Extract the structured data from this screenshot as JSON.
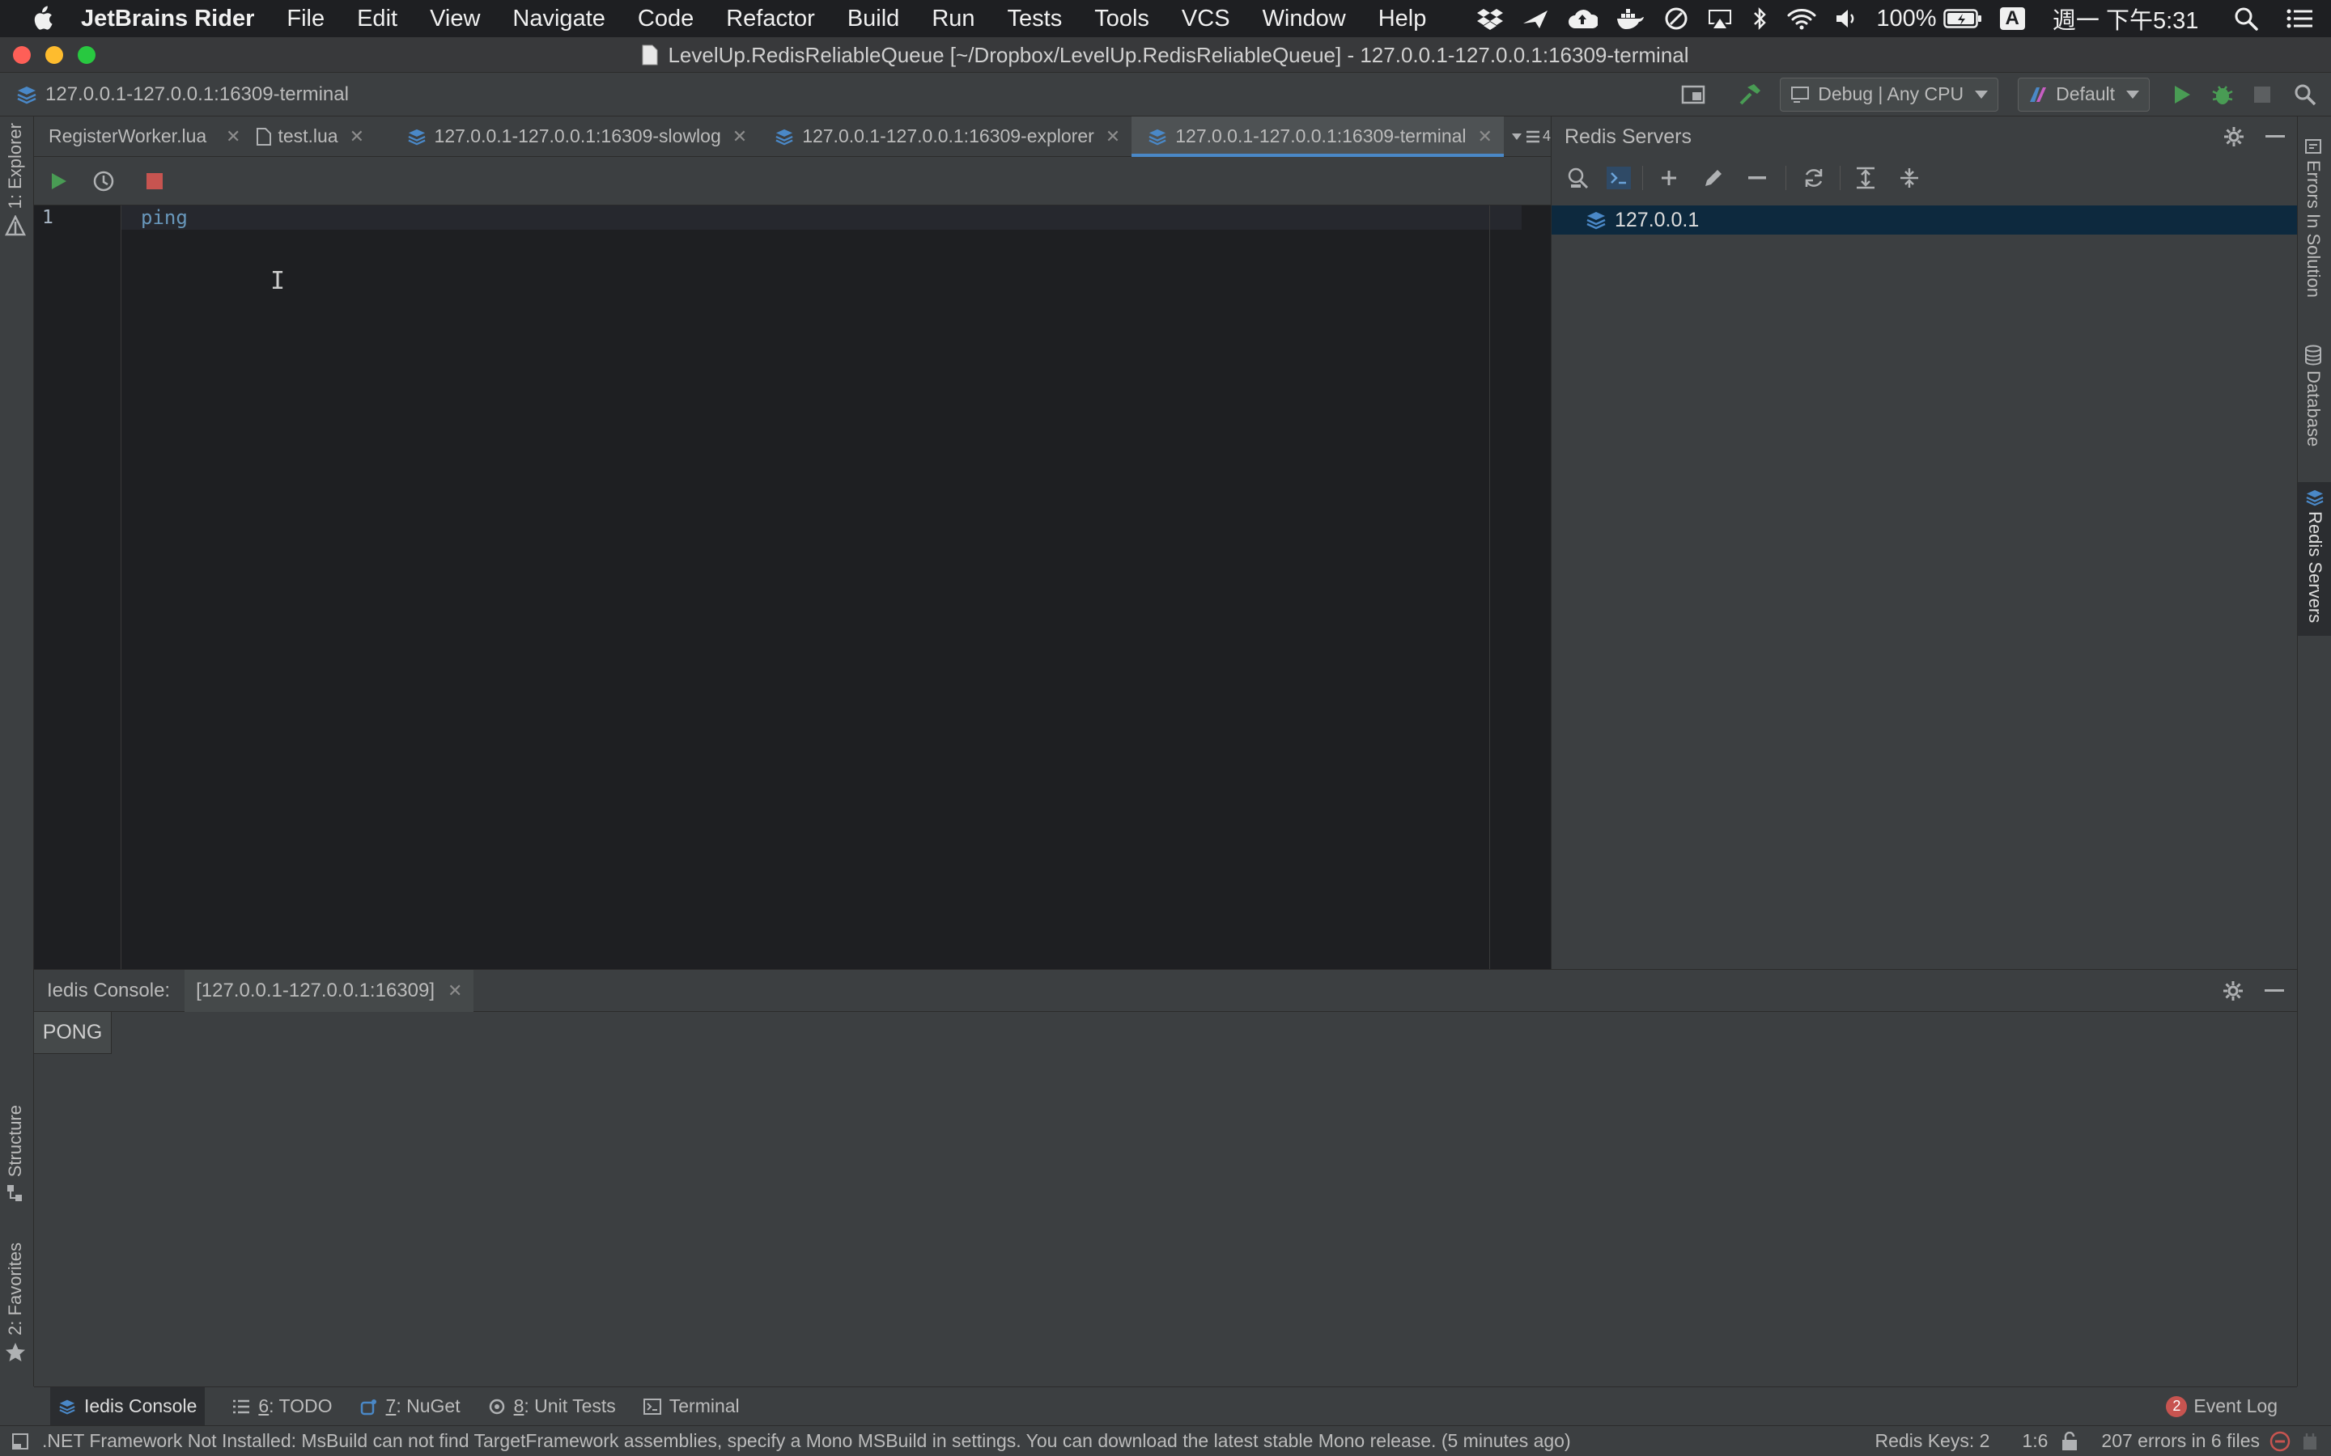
{
  "menubar": {
    "app_name": "JetBrains Rider",
    "items": [
      "File",
      "Edit",
      "View",
      "Navigate",
      "Code",
      "Refactor",
      "Build",
      "Run",
      "Tests",
      "Tools",
      "VCS",
      "Window",
      "Help"
    ],
    "battery": "100%",
    "input_method": "A",
    "clock": "週一 下午5:31"
  },
  "window": {
    "title": "LevelUp.RedisReliableQueue [~/Dropbox/LevelUp.RedisReliableQueue] - 127.0.0.1-127.0.0.1:16309-terminal"
  },
  "navbar": {
    "breadcrumb": "127.0.0.1-127.0.0.1:16309-terminal",
    "config": "Debug | Any CPU",
    "run_target": "Default"
  },
  "tabs": [
    {
      "label": "RegisterWorker.lua"
    },
    {
      "label": "test.lua"
    },
    {
      "label": "127.0.0.1-127.0.0.1:16309-slowlog"
    },
    {
      "label": "127.0.0.1-127.0.0.1:16309-explorer"
    },
    {
      "label": "127.0.0.1-127.0.0.1:16309-terminal"
    }
  ],
  "tabs_overflow": "4",
  "editor": {
    "line_number": "1",
    "code": "ping"
  },
  "left_strip": {
    "top_label": "1: Explorer",
    "structure_label": "Structure",
    "favorites_label": "2: Favorites"
  },
  "right_strip": {
    "errors_label": "Errors In Solution",
    "database_label": "Database",
    "redis_label": "Redis Servers"
  },
  "redis_panel": {
    "title": "Redis Servers",
    "server": "127.0.0.1"
  },
  "console": {
    "label": "Iedis Console:",
    "tab": "[127.0.0.1-127.0.0.1:16309]",
    "output": "PONG"
  },
  "bottom_tools": {
    "console": "Iedis Console",
    "todo_num": "6",
    "todo": ": TODO",
    "nuget_num": "7",
    "nuget": ": NuGet",
    "tests_num": "8",
    "tests": ": Unit Tests",
    "terminal": "Terminal",
    "event_count": "2",
    "event_log": "Event Log"
  },
  "status": {
    "message": ".NET Framework Not Installed: MsBuild can not find TargetFramework assemblies, specify a Mono MSBuild in settings. You can download the latest stable Mono release.  (5 minutes ago)",
    "redis_keys": "Redis Keys: 2",
    "position": "1:6",
    "errors": "207 errors in 6 files"
  },
  "colors": {
    "accent": "#4a88c7",
    "run_green": "#499c54",
    "stop_red": "#c75450",
    "selection": "#0d293e"
  }
}
